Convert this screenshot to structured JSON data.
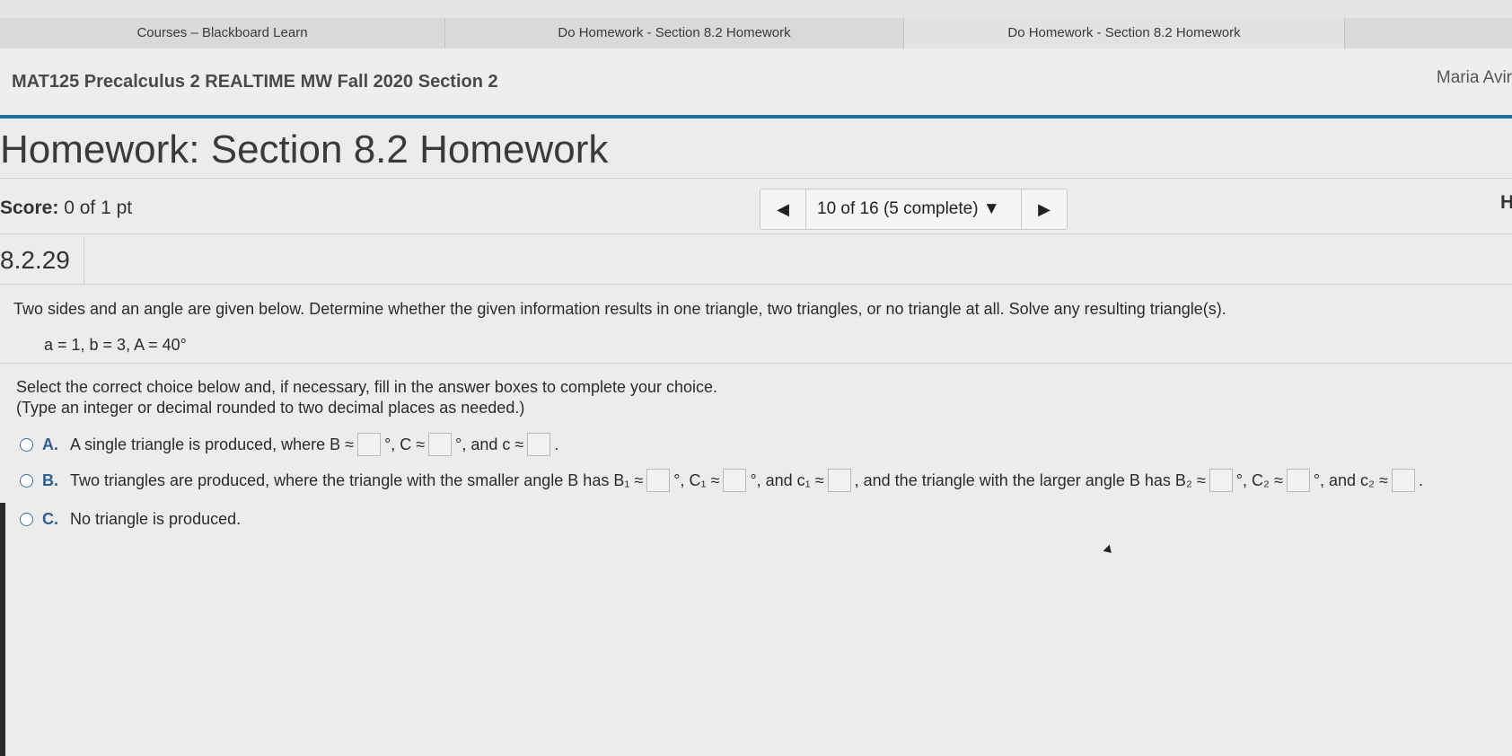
{
  "tabs": [
    {
      "label": "Courses – Blackboard Learn"
    },
    {
      "label": "Do Homework - Section 8.2 Homework"
    },
    {
      "label": "Do Homework - Section 8.2 Homework"
    }
  ],
  "header": {
    "course_title": "MAT125 Precalculus 2 REALTIME MW Fall 2020 Section 2",
    "user_name": "Maria Avir"
  },
  "page": {
    "title": "Homework: Section 8.2 Homework",
    "score_label": "Score:",
    "score_value": "0 of 1 pt",
    "help_letter": "H"
  },
  "navigator": {
    "prev_icon": "◀",
    "label": "10 of 16 (5 complete)",
    "dropdown_icon": "▼",
    "next_icon": "▶"
  },
  "question": {
    "id": "8.2.29",
    "text": "Two sides and an angle are given below. Determine whether the given information results in one triangle, two triangles, or no triangle at all. Solve any resulting triangle(s).",
    "given": "a = 1, b = 3, A = 40°",
    "instruction_1": "Select the correct choice below and, if necessary, fill in the answer boxes to complete your choice.",
    "instruction_2": "(Type an integer or decimal rounded to two decimal places as needed.)"
  },
  "choices": {
    "a": {
      "letter": "A.",
      "p1": "A single triangle is produced, where B ≈",
      "p2": "°, C ≈",
      "p3": "°, and c ≈",
      "p4": "."
    },
    "b": {
      "letter": "B.",
      "p1": "Two triangles are produced, where the triangle with the smaller angle B has B₁ ≈",
      "p2": "°, C₁ ≈",
      "p3": "°, and c₁ ≈",
      "p4": ", and the triangle with the larger angle B has B₂ ≈",
      "p5": "°, C₂ ≈",
      "p6": "°, and c₂ ≈",
      "p7": "."
    },
    "c": {
      "letter": "C.",
      "text": "No triangle is produced."
    }
  },
  "colors": {
    "accent_bar": "#1f6f9a",
    "choice_letter": "#2d5f93"
  }
}
